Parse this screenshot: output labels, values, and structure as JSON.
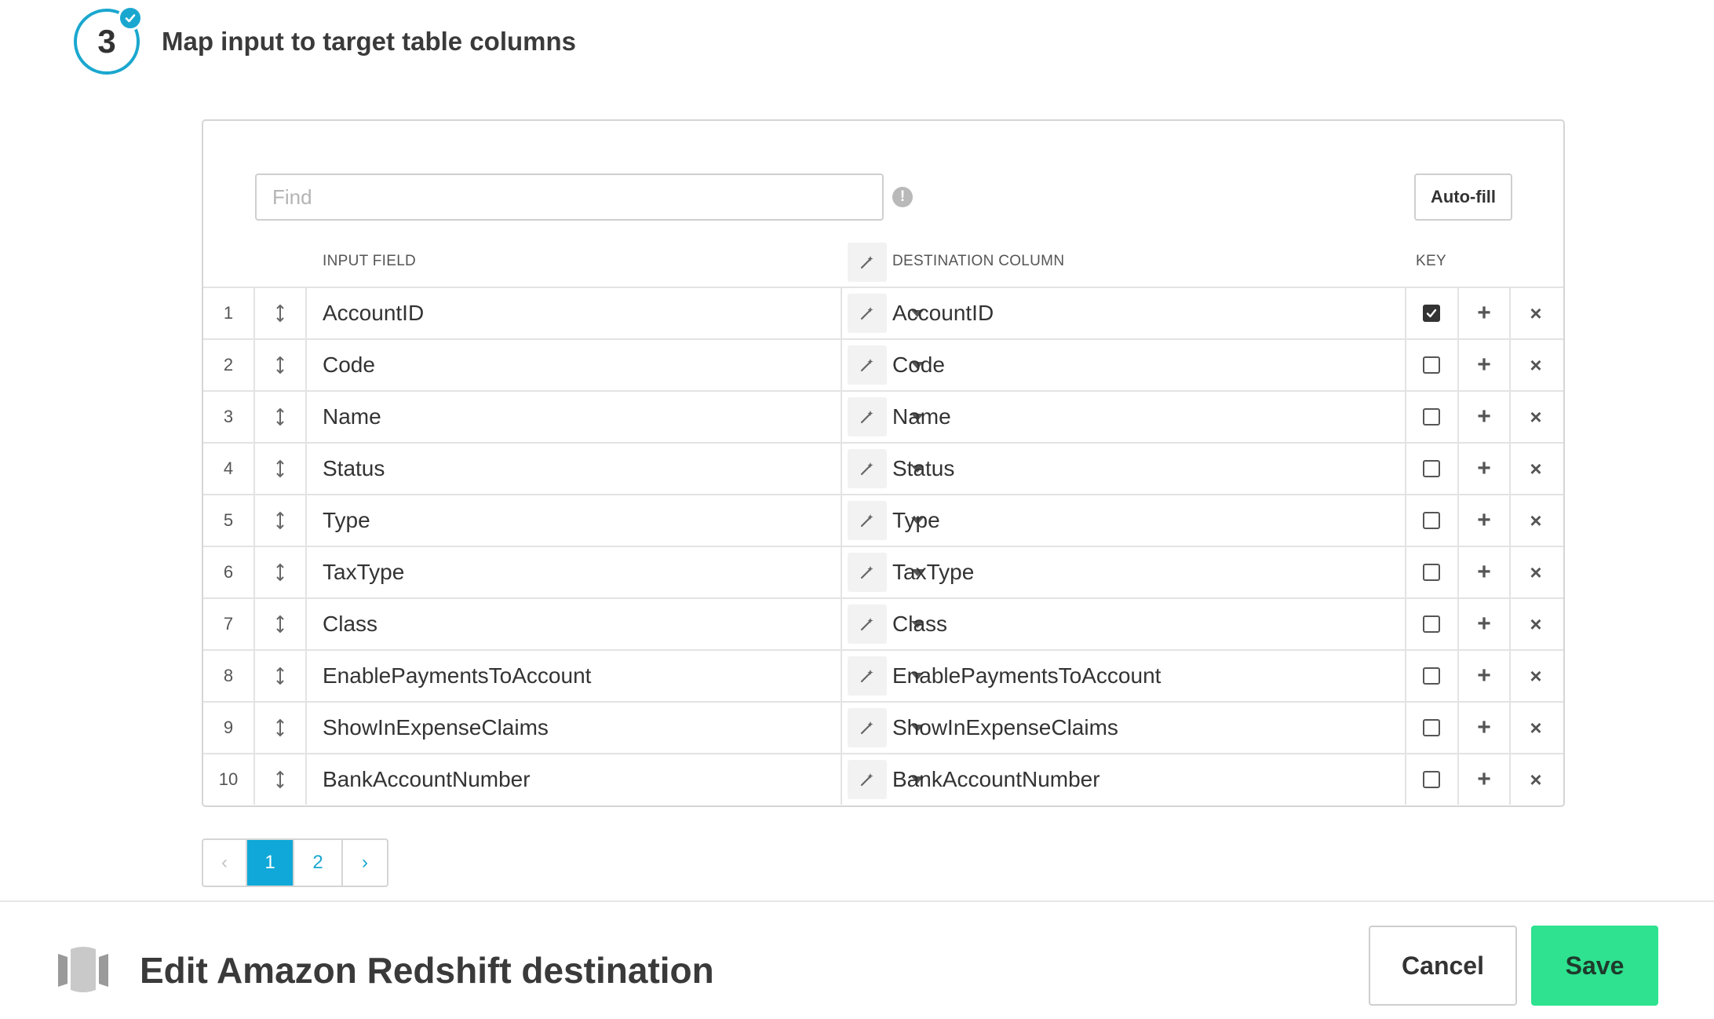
{
  "step": {
    "number": "3",
    "title": "Map input to target table columns"
  },
  "toolbar": {
    "find_placeholder": "Find",
    "autofill_label": "Auto-fill"
  },
  "columns": {
    "input_field": "INPUT FIELD",
    "destination_column": "DESTINATION COLUMN",
    "key": "KEY"
  },
  "rows": [
    {
      "num": "1",
      "input": "AccountID",
      "destination": "AccountID",
      "key": true
    },
    {
      "num": "2",
      "input": "Code",
      "destination": "Code",
      "key": false
    },
    {
      "num": "3",
      "input": "Name",
      "destination": "Name",
      "key": false
    },
    {
      "num": "4",
      "input": "Status",
      "destination": "Status",
      "key": false
    },
    {
      "num": "5",
      "input": "Type",
      "destination": "Type",
      "key": false
    },
    {
      "num": "6",
      "input": "TaxType",
      "destination": "TaxType",
      "key": false
    },
    {
      "num": "7",
      "input": "Class",
      "destination": "Class",
      "key": false
    },
    {
      "num": "8",
      "input": "EnablePaymentsToAccount",
      "destination": "EnablePaymentsToAccount",
      "key": false
    },
    {
      "num": "9",
      "input": "ShowInExpenseClaims",
      "destination": "ShowInExpenseClaims",
      "key": false
    },
    {
      "num": "10",
      "input": "BankAccountNumber",
      "destination": "BankAccountNumber",
      "key": false
    }
  ],
  "pagination": {
    "prev": "‹",
    "pages": [
      "1",
      "2"
    ],
    "current": "1",
    "next": "›"
  },
  "footer": {
    "title": "Edit Amazon Redshift destination",
    "cancel_label": "Cancel",
    "save_label": "Save"
  },
  "colors": {
    "accent": "#1aa7cf",
    "save": "#2ee28f",
    "active_page": "#0fa8d8"
  }
}
